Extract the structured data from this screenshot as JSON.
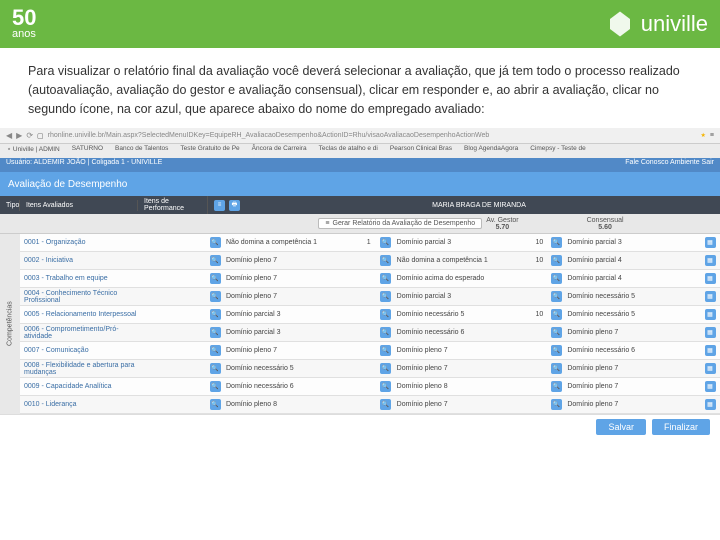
{
  "header": {
    "logo_years": "50",
    "logo_sub": "anos",
    "brand": "univille"
  },
  "instruction": "Para visualizar o relatório final da avaliação você deverá selecionar a avaliação, que já tem todo o processo realizado (autoavaliação, avaliação do gestor e avaliação consensual), clicar em responder e, ao abrir a avaliação, clicar no segundo ícone, na cor azul, que aparece abaixo do nome do empregado avaliado:",
  "browser": {
    "url": "rhonline.univille.br/Main.aspx?SelectedMenuIDKey=EquipeRH_AvaliacaoDesempenho&ActionID=Rhu/visaoAvaliacaoDesempenhoActionWeb",
    "tabs": [
      "⋆ Univille | ADMIN",
      "SATURNO",
      "Banco de Talentos",
      "Teste Gratuito de Pe",
      "Âncora de Carreira",
      "Teclas de atalho e di",
      "Pearson Clinical Bras",
      "Blog AgendaAgora",
      "Cimepsy - Teste de"
    ]
  },
  "userbar": {
    "left": "Usuário: ALDEMIR JOÃO | Coligada 1 - UNIVILLE",
    "right": "Fale Conosco   Ambiente   Sair"
  },
  "titlebar": {
    "title": "Avaliação de Desempenho",
    "employee": "MARIA BRAGA DE MIRANDA"
  },
  "cols": {
    "tipo": "Tipo",
    "items": "Itens Avaliados",
    "perf": "Itens de Performance"
  },
  "center": {
    "report_btn": "Gerar Relatório da Avaliação de Desempenho",
    "gestor_label": "Av. Gestor",
    "gestor_val": "5.70",
    "cons_label": "Consensual",
    "cons_val": "5.60"
  },
  "sidebar": "Competências",
  "rows": [
    {
      "id": "0001 - Organização",
      "a": "Não domina a competência 1",
      "an": "1",
      "b": "Domínio parcial 3",
      "bn": "10",
      "c": "Domínio parcial 3",
      "cn": ""
    },
    {
      "id": "0002 - Iniciativa",
      "a": "Domínio pleno 7",
      "an": "",
      "b": "Não domina a competência 1",
      "bn": "10",
      "c": "Domínio parcial 4",
      "cn": ""
    },
    {
      "id": "0003 - Trabalho em equipe",
      "a": "Domínio pleno 7",
      "an": "",
      "b": "Domínio acima do esperado",
      "bn": "",
      "c": "Domínio parcial 4",
      "cn": ""
    },
    {
      "id": "0004 - Conhecimento Técnico Profissional",
      "a": "Domínio pleno 7",
      "an": "",
      "b": "Domínio parcial 3",
      "bn": "",
      "c": "Domínio necessário 5",
      "cn": ""
    },
    {
      "id": "0005 - Relacionamento Interpessoal",
      "a": "Domínio parcial 3",
      "an": "",
      "b": "Domínio necessário 5",
      "bn": "10",
      "c": "Domínio necessário 5",
      "cn": ""
    },
    {
      "id": "0006 - Comprometimento/Pró-atividade",
      "a": "Domínio parcial 3",
      "an": "",
      "b": "Domínio necessário 6",
      "bn": "",
      "c": "Domínio pleno 7",
      "cn": ""
    },
    {
      "id": "0007 - Comunicação",
      "a": "Domínio pleno 7",
      "an": "",
      "b": "Domínio pleno 7",
      "bn": "",
      "c": "Domínio necessário 6",
      "cn": ""
    },
    {
      "id": "0008 - Flexibilidade e abertura para mudanças",
      "a": "Domínio necessário 5",
      "an": "",
      "b": "Domínio pleno 7",
      "bn": "",
      "c": "Domínio pleno 7",
      "cn": ""
    },
    {
      "id": "0009 - Capacidade Analítica",
      "a": "Domínio necessário 6",
      "an": "",
      "b": "Domínio pleno 8",
      "bn": "",
      "c": "Domínio pleno 7",
      "cn": ""
    },
    {
      "id": "0010 - Liderança",
      "a": "Domínio pleno 8",
      "an": "",
      "b": "Domínio pleno 7",
      "bn": "",
      "c": "Domínio pleno 7",
      "cn": ""
    }
  ],
  "footer": {
    "save": "Salvar",
    "final": "Finalizar"
  }
}
